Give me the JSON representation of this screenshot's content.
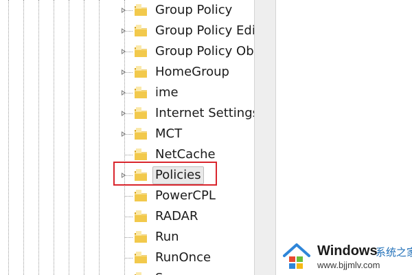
{
  "tree": {
    "items": [
      {
        "label": "Group Policy",
        "expandable": true,
        "selected": false
      },
      {
        "label": "Group Policy Edi",
        "expandable": true,
        "selected": false
      },
      {
        "label": "Group Policy Ob",
        "expandable": true,
        "selected": false
      },
      {
        "label": "HomeGroup",
        "expandable": true,
        "selected": false
      },
      {
        "label": "ime",
        "expandable": true,
        "selected": false
      },
      {
        "label": "Internet Settings",
        "expandable": true,
        "selected": false
      },
      {
        "label": "MCT",
        "expandable": true,
        "selected": false
      },
      {
        "label": "NetCache",
        "expandable": false,
        "selected": false
      },
      {
        "label": "Policies",
        "expandable": true,
        "selected": true
      },
      {
        "label": "PowerCPL",
        "expandable": false,
        "selected": false
      },
      {
        "label": "RADAR",
        "expandable": false,
        "selected": false
      },
      {
        "label": "Run",
        "expandable": false,
        "selected": false
      },
      {
        "label": "RunOnce",
        "expandable": false,
        "selected": false
      },
      {
        "label": "S",
        "expandable": false,
        "selected": false
      }
    ]
  },
  "highlight": {
    "color": "#d9242c",
    "target": "Policies"
  },
  "watermark": {
    "title": "Windows",
    "title_cn": "系统之家",
    "url": "www.bjjmlv.com",
    "icon": "windows-house-logo"
  },
  "colors": {
    "folder": "#f2c94c",
    "folder_dark": "#d9a520",
    "accent_blue": "#1f6fb8",
    "highlight_red": "#d9242c"
  }
}
